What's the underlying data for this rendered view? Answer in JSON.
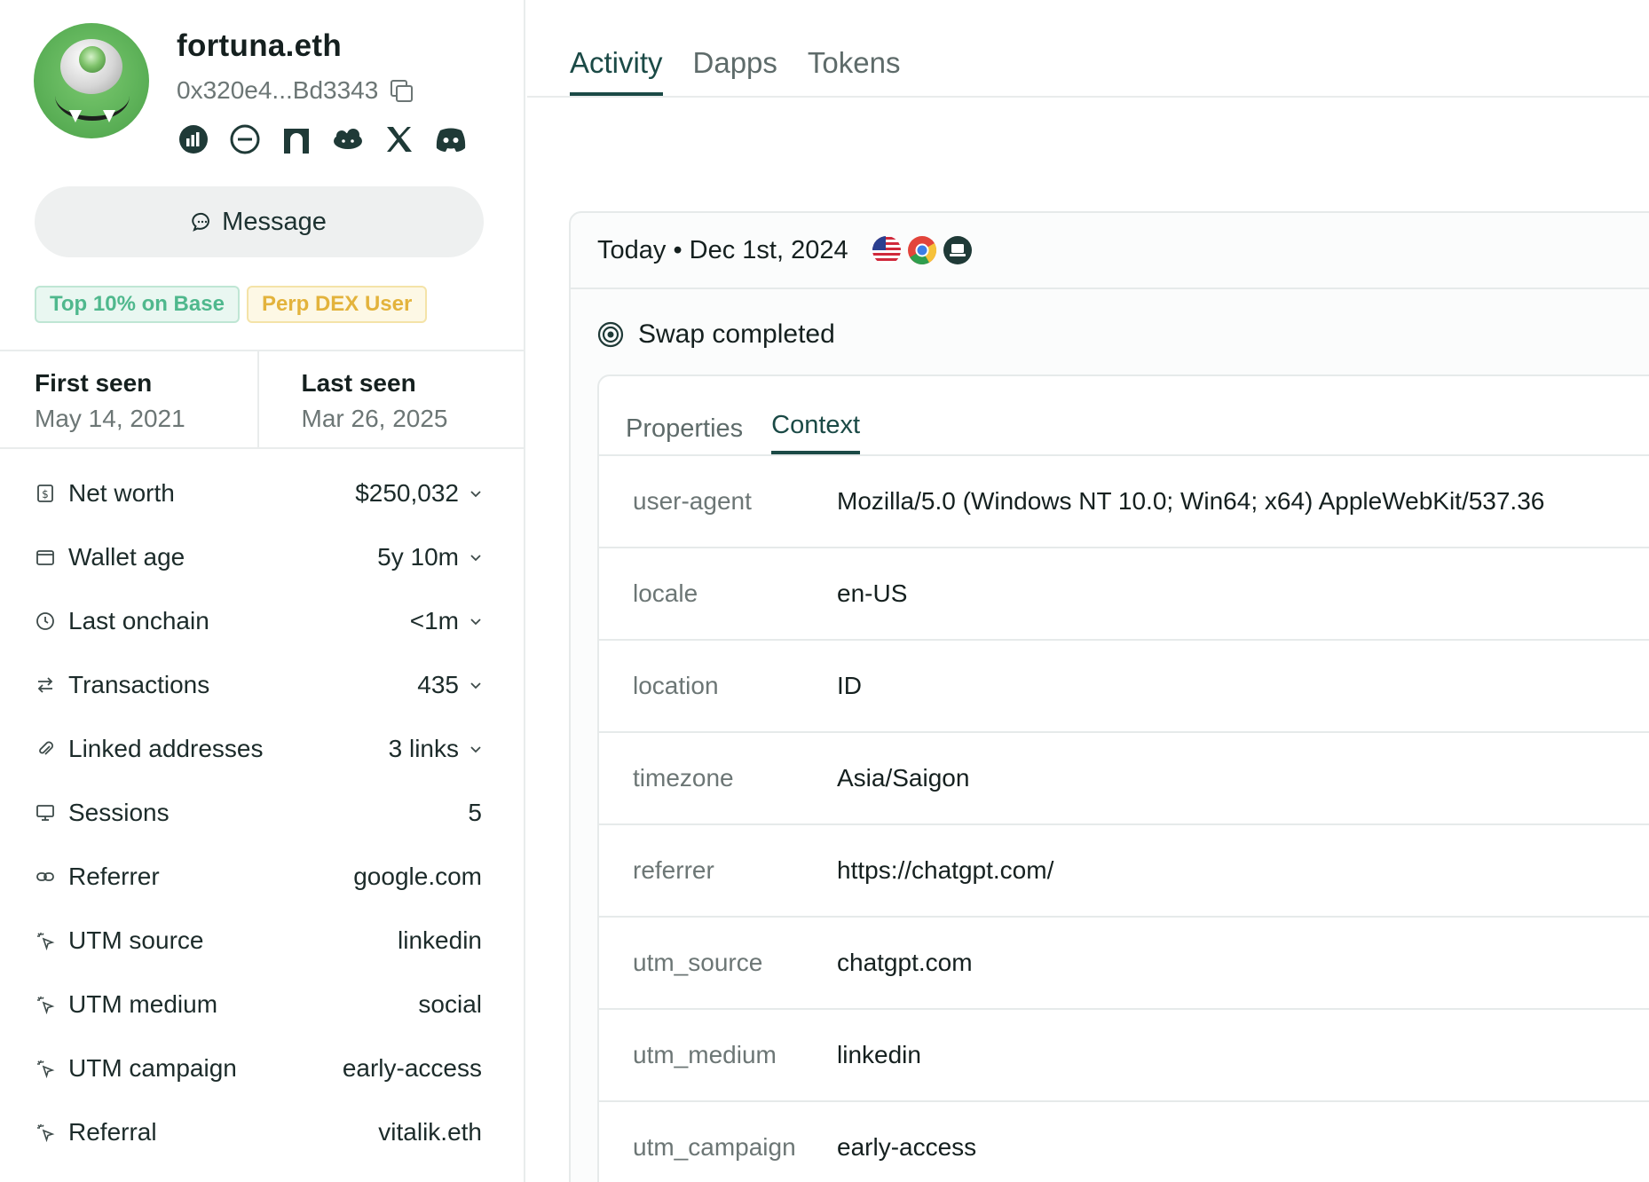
{
  "profile": {
    "name": "fortuna.eth",
    "address": "0x320e4...Bd3343",
    "socials": [
      "chart-icon",
      "lens-icon",
      "arch-icon",
      "cloud-icon",
      "x-icon",
      "discord-icon"
    ],
    "message_label": "Message",
    "badges": [
      "Top 10% on Base",
      "Perp DEX User"
    ]
  },
  "seen": {
    "first_label": "First seen",
    "first_value": "May 14, 2021",
    "last_label": "Last seen",
    "last_value": "Mar 26, 2025"
  },
  "stats": [
    {
      "icon": "dollar-icon",
      "label": "Net worth",
      "value": "$250,032",
      "expandable": true
    },
    {
      "icon": "wallet-icon",
      "label": "Wallet age",
      "value": "5y 10m",
      "expandable": true
    },
    {
      "icon": "clock-icon",
      "label": "Last onchain",
      "value": "<1m",
      "expandable": true
    },
    {
      "icon": "arrows-icon",
      "label": "Transactions",
      "value": "435",
      "expandable": true
    },
    {
      "icon": "paperclip-icon",
      "label": "Linked addresses",
      "value": "3 links",
      "expandable": true
    },
    {
      "icon": "monitor-icon",
      "label": "Sessions",
      "value": "5",
      "expandable": false
    },
    {
      "icon": "link-icon",
      "label": "Referrer",
      "value": "google.com",
      "expandable": false
    },
    {
      "icon": "sparkle-cursor-icon",
      "label": "UTM source",
      "value": "linkedin",
      "expandable": false
    },
    {
      "icon": "sparkle-cursor-icon",
      "label": "UTM medium",
      "value": "social",
      "expandable": false
    },
    {
      "icon": "sparkle-cursor-icon",
      "label": "UTM campaign",
      "value": "early-access",
      "expandable": false
    },
    {
      "icon": "sparkle-cursor-icon",
      "label": "Referral",
      "value": "vitalik.eth",
      "expandable": false
    }
  ],
  "tabs": [
    "Activity",
    "Dapps",
    "Tokens"
  ],
  "activity": {
    "date": "Today • Dec 1st, 2024",
    "header_icons": [
      "us-flag-icon",
      "chrome-icon",
      "desktop-icon"
    ],
    "event": "Swap completed",
    "inner_tabs": [
      "Properties",
      "Context"
    ],
    "context": [
      {
        "key": "user-agent",
        "value": "Mozilla/5.0 (Windows NT 10.0; Win64; x64) AppleWebKit/537.36"
      },
      {
        "key": "locale",
        "value": "en-US"
      },
      {
        "key": "location",
        "value": "ID"
      },
      {
        "key": "timezone",
        "value": "Asia/Saigon"
      },
      {
        "key": "referrer",
        "value": "https://chatgpt.com/"
      },
      {
        "key": "utm_source",
        "value": "chatgpt.com"
      },
      {
        "key": "utm_medium",
        "value": "linkedin"
      },
      {
        "key": "utm_campaign",
        "value": "early-access"
      }
    ]
  },
  "colors": {
    "accent": "#1b4a46",
    "muted_text": "#6c7675",
    "badge_green": "#4fb88d",
    "badge_yellow": "#e3b33c"
  }
}
